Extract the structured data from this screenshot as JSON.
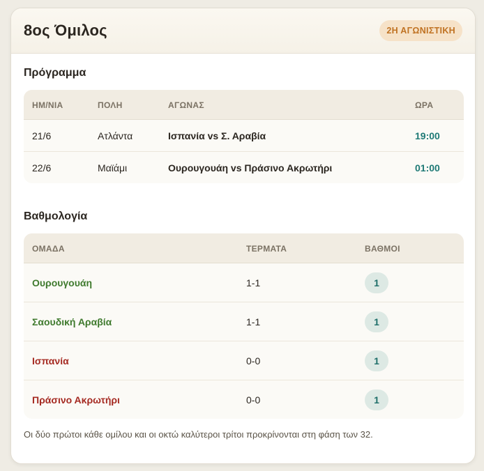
{
  "header": {
    "title": "8ος Όμιλος",
    "round_badge": "2Η ΑΓΩΝΙΣΤΙΚΗ"
  },
  "schedule": {
    "title": "Πρόγραμμα",
    "columns": [
      "ΗΜ/ΝΙΑ",
      "ΠΟΛΗ",
      "ΑΓΩΝΑΣ",
      "ΩΡΑ"
    ],
    "rows": [
      {
        "date": "21/6",
        "city": "Ατλάντα",
        "match": "Ισπανία vs Σ. Αραβία",
        "time": "19:00"
      },
      {
        "date": "22/6",
        "city": "Μαϊάμι",
        "match": "Ουρουγουάη vs Πράσινο Ακρωτήρι",
        "time": "01:00"
      }
    ]
  },
  "standings": {
    "title": "Βαθμολογία",
    "columns": [
      "ΟΜΑΔΑ",
      "ΤΕΡΜΑΤΑ",
      "ΒΑΘΜΟΙ"
    ],
    "rows": [
      {
        "team": "Ουρουγουάη",
        "goals": "1-1",
        "points": "1",
        "status": "qual"
      },
      {
        "team": "Σαουδική Αραβία",
        "goals": "1-1",
        "points": "1",
        "status": "qual"
      },
      {
        "team": "Ισπανία",
        "goals": "0-0",
        "points": "1",
        "status": "out"
      },
      {
        "team": "Πράσινο Ακρωτήρι",
        "goals": "0-0",
        "points": "1",
        "status": "out"
      }
    ]
  },
  "footnote": "Οι δύο πρώτοι κάθε ομίλου και οι οκτώ καλύτεροι τρίτοι προκρίνονται στη φάση των 32.",
  "colors": {
    "qualified_team": "#3f7a2e",
    "eliminated_team": "#a52a22",
    "time": "#1f7a76",
    "badge_accent": "#c07222"
  }
}
